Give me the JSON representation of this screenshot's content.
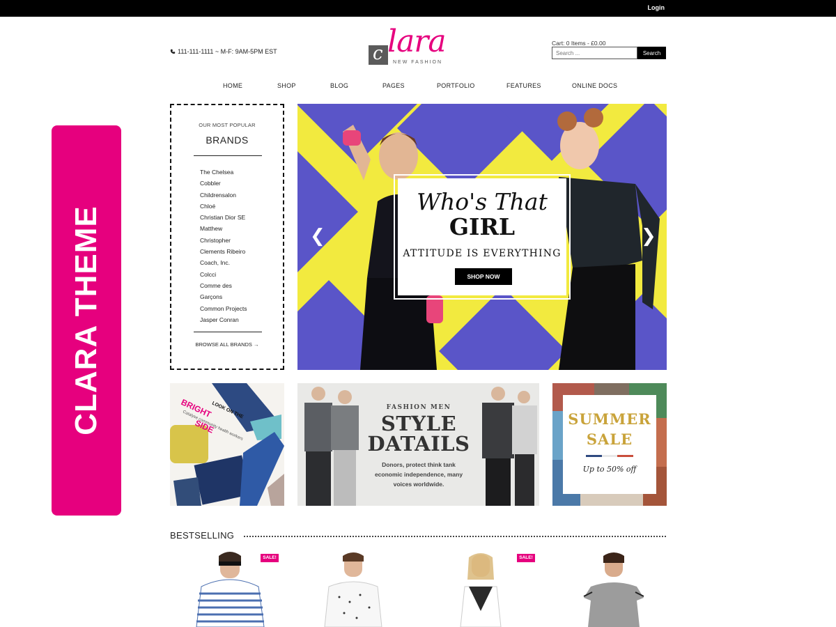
{
  "top_bar": {
    "login_label": "Login"
  },
  "header": {
    "phone": "111-111-1111 ~ M-F: 9AM-5PM EST",
    "logo_text": "lara",
    "logo_letter": "c",
    "logo_tagline": "NEW FASHION",
    "cart_text": "Cart: 0 Items - £0.00",
    "search_placeholder": "Search ...",
    "search_button": "Search"
  },
  "nav": {
    "items": [
      {
        "label": "HOME"
      },
      {
        "label": "SHOP"
      },
      {
        "label": "BLOG"
      },
      {
        "label": "PAGES"
      },
      {
        "label": "PORTFOLIO"
      },
      {
        "label": "FEATURES"
      },
      {
        "label": "ONLINE DOCS"
      }
    ]
  },
  "brands": {
    "subtitle": "OUR MOST POPULAR",
    "title": "BRANDS",
    "items": [
      "The Chelsea",
      "Cobbler",
      "Childrensalon",
      "Chloé",
      "Christian Dior SE",
      "Matthew",
      "Christopher",
      "Clements Ribeiro",
      "Coach, Inc.",
      "Colcci",
      "Comme des",
      "Garçons",
      "Common Projects",
      "Jasper Conran"
    ],
    "browse_label": "BROWSE ALL BRANDS →"
  },
  "hero": {
    "line1": "Who's That",
    "line2": "GIRL",
    "line3": "ATTITUDE IS EVERYTHING",
    "button": "SHOP NOW",
    "prev_icon": "❮",
    "next_icon": "❯"
  },
  "banners": {
    "left": {
      "top_text": "LOOK ON THE",
      "big_text": "BRIGHT SIDE",
      "small_text": "Catalyse community health workers"
    },
    "center": {
      "small": "FASHION MEN",
      "line1": "STYLE",
      "line2": "DATAILS",
      "desc1": "Donors, protect think tank",
      "desc2": "economic independence, many",
      "desc3": "voices worldwide."
    },
    "right": {
      "line1": "SUMMER",
      "line2": "SALE",
      "line3": "Up to 50% off"
    }
  },
  "bestselling": {
    "title": "BESTSELLING",
    "sale_badge": "SALE!"
  },
  "side_label": "CLARA THEME",
  "colors": {
    "brand_pink": "#e6007e",
    "hero_yellow": "#f2ea3f",
    "hero_purple": "#5a55c8",
    "gold": "#c9a33a"
  }
}
